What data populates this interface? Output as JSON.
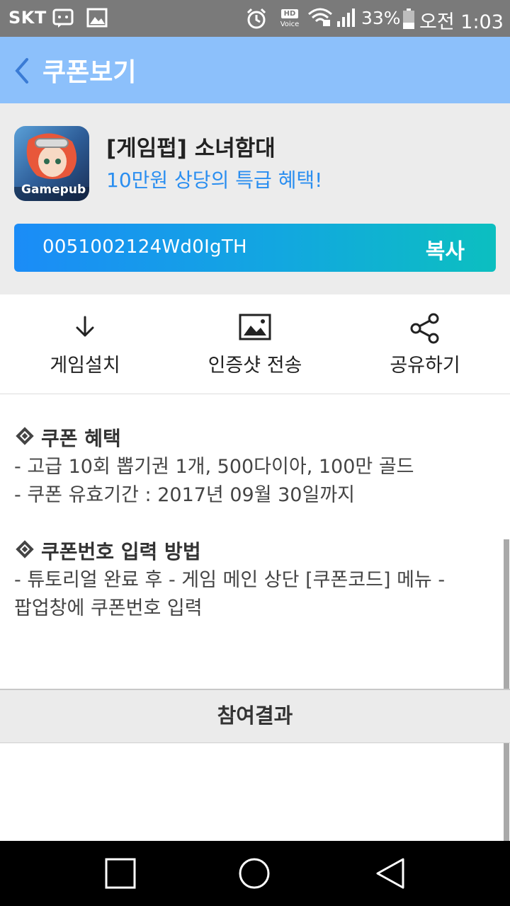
{
  "status_bar": {
    "carrier": "SKT",
    "battery_percent": "33%",
    "time": "오전 1:03",
    "icons": [
      "chat-icon",
      "image-icon",
      "alarm-icon",
      "hd-voice-icon",
      "wifi-icon",
      "signal-icon",
      "battery-icon"
    ],
    "hd_label": "HD",
    "voice_label": "Voice"
  },
  "app_bar": {
    "title": "쿠폰보기",
    "back_icon": "chevron-left-icon"
  },
  "game": {
    "name": "[게임펍] 소녀함대",
    "subtitle": "10만원 상당의 특급 혜택!",
    "icon_label": "Gamepub"
  },
  "coupon": {
    "code": "0051002124Wd0IgTH",
    "copy_label": "복사"
  },
  "actions": [
    {
      "label": "게임설치",
      "icon": "download-icon"
    },
    {
      "label": "인증샷 전송",
      "icon": "image-icon"
    },
    {
      "label": "공유하기",
      "icon": "share-icon"
    }
  ],
  "sections": [
    {
      "title": "쿠폰 혜택",
      "lines": [
        "- 고급 10회 뽑기권 1개, 500다이아, 100만 골드",
        "- 쿠폰 유효기간 : 2017년 09월 30일까지"
      ]
    },
    {
      "title": "쿠폰번호 입력 방법",
      "lines": [
        "- 튜토리얼 완료 후 - 게임 메인 상단 [쿠폰코드] 메뉴 -",
        "팝업창에 쿠폰번호 입력"
      ]
    }
  ],
  "result_button": {
    "label": "참여결과"
  },
  "nav": {
    "buttons": [
      "recents-icon",
      "home-icon",
      "back-triangle-icon"
    ]
  },
  "colors": {
    "app_bar": "#8cc0fb",
    "accent_text": "#2a8ef0",
    "coupon_gradient_start": "#1b8cf7",
    "coupon_gradient_end": "#0cbfc0"
  }
}
